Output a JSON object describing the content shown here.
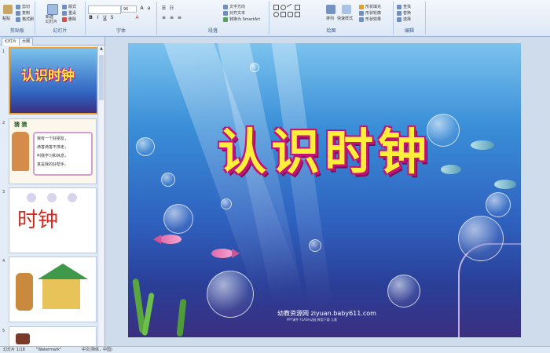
{
  "ribbon": {
    "groups": [
      {
        "label": "剪贴板"
      },
      {
        "label": "幻灯片"
      },
      {
        "label": "字体"
      },
      {
        "label": "段落"
      },
      {
        "label": "绘图"
      },
      {
        "label": "编辑"
      }
    ],
    "clipboard": {
      "paste": "粘贴",
      "cut": "剪切",
      "copy": "复制",
      "format_painter": "格式刷"
    },
    "slides": {
      "new_slide": "新建\n幻灯片",
      "layout": "版式",
      "reset": "重设",
      "delete": "删除"
    },
    "font": {
      "size": "96"
    },
    "paragraph": {
      "text_direction": "文字方向",
      "align_text": "对齐文本",
      "smartart": "转换为 SmartArt"
    },
    "drawing": {
      "arrange": "排列",
      "quick_styles": "快速样式",
      "fill": "形状填充",
      "outline": "形状轮廓",
      "effects": "形状效果"
    },
    "editing": {
      "find": "查找",
      "replace": "替换",
      "select": "选择"
    }
  },
  "left_panel": {
    "tabs": [
      "幻灯片",
      "大纲"
    ],
    "slides": [
      {
        "number": "1",
        "title": "认识时钟"
      },
      {
        "number": "2",
        "title": "猜  猜",
        "lines": [
          "我有一个好朋友，",
          "滴答滴答不停走，",
          "叫我学习和休息，",
          "真是我的好帮手。"
        ]
      },
      {
        "number": "3",
        "title": "时钟"
      },
      {
        "number": "4"
      },
      {
        "number": "5"
      }
    ]
  },
  "slide": {
    "title": "认识时钟",
    "watermark": "幼教资源网 ziyuan.baby611.com",
    "watermark_sub": "PPT课件  FLASH动画  教案下载  儿歌"
  },
  "status": {
    "slide_counter": "幻灯片 1/18",
    "theme": "\"Watermark\"",
    "language": "中文(简体，中国)"
  },
  "colors": {
    "title_fill": "#ffef3a",
    "title_outline": "#c3127a",
    "selection": "#f0a030"
  }
}
